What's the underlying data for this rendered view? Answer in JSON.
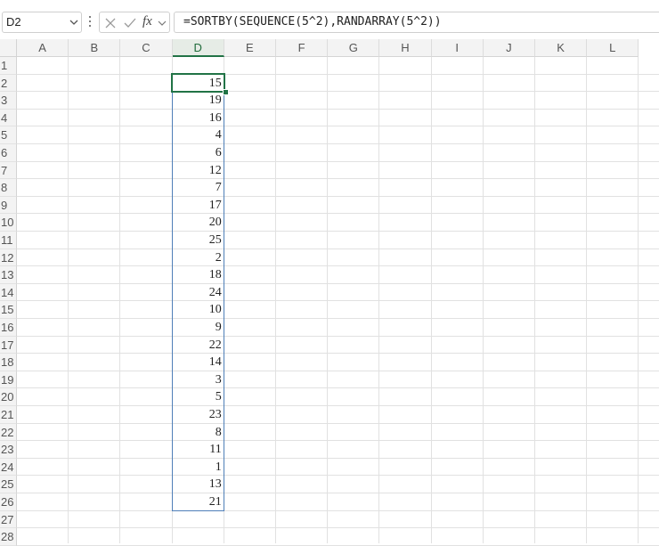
{
  "formula_bar": {
    "name_box": "D2",
    "fx_label": "fx",
    "formula": "=SORTBY(SEQUENCE(5^2),RANDARRAY(5^2))"
  },
  "columns": [
    "A",
    "B",
    "C",
    "D",
    "E",
    "F",
    "G",
    "H",
    "I",
    "J",
    "K",
    "L"
  ],
  "selected_column": "D",
  "rows": [
    "1",
    "2",
    "3",
    "4",
    "5",
    "6",
    "7",
    "8",
    "9",
    "10",
    "11",
    "12",
    "13",
    "14",
    "15",
    "16",
    "17",
    "18",
    "19",
    "20",
    "21",
    "22",
    "23",
    "24",
    "25",
    "26",
    "27",
    "28"
  ],
  "column_d_values": [
    "15",
    "19",
    "16",
    "4",
    "6",
    "12",
    "7",
    "17",
    "20",
    "25",
    "2",
    "18",
    "24",
    "10",
    "9",
    "22",
    "14",
    "3",
    "5",
    "23",
    "8",
    "11",
    "1",
    "13",
    "21"
  ],
  "active_cell": "D2",
  "colors": {
    "selection_green": "#217346",
    "spill_border_blue": "#4f7fb8",
    "header_bg": "#f3f3f3",
    "gridline": "#e1e1e1"
  }
}
